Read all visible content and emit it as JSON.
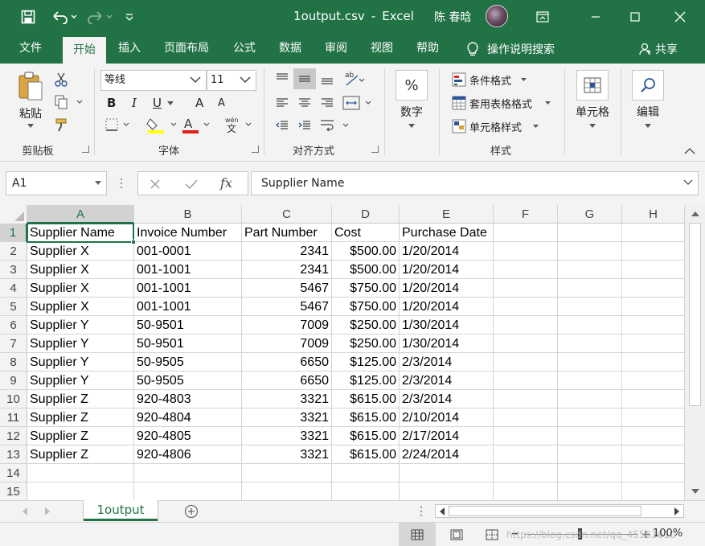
{
  "title_bar": {
    "file_name": "1output.csv",
    "separator": "-",
    "app_name": "Excel",
    "user_name": "陈 春晗"
  },
  "menu": {
    "tabs": [
      "文件",
      "开始",
      "插入",
      "页面布局",
      "公式",
      "数据",
      "审阅",
      "视图",
      "帮助"
    ],
    "active_tab": "开始",
    "tell_me": "操作说明搜索",
    "share": "共享"
  },
  "ribbon": {
    "clipboard": {
      "paste": "粘贴",
      "group_label": "剪贴板"
    },
    "font": {
      "font_name": "等线",
      "font_size": "11",
      "bold": "B",
      "italic": "I",
      "underline": "U",
      "grow": "A",
      "shrink": "A",
      "phonetic": "wén",
      "group_label": "字体"
    },
    "alignment": {
      "group_label": "对齐方式"
    },
    "number": {
      "percent_symbol": "%",
      "label": "数字"
    },
    "styles": {
      "conditional_format": "条件格式",
      "format_as_table": "套用表格格式",
      "cell_styles": "单元格样式",
      "group_label": "样式"
    },
    "cells": {
      "label": "单元格"
    },
    "editing": {
      "label": "编辑"
    }
  },
  "formula_bar": {
    "name_box": "A1",
    "fx": "fx",
    "content": "Supplier Name"
  },
  "sheet": {
    "columns": [
      "A",
      "B",
      "C",
      "D",
      "E",
      "F",
      "G",
      "H"
    ],
    "selected_column": "A",
    "selected_row": "1",
    "row_numbers": [
      "1",
      "2",
      "3",
      "4",
      "5",
      "6",
      "7",
      "8",
      "9",
      "10",
      "11",
      "12",
      "13",
      "14",
      "15"
    ],
    "rows": [
      [
        "Supplier Name",
        "Invoice Number",
        "Part Number",
        "Cost",
        "Purchase Date"
      ],
      [
        "Supplier X",
        "001-0001",
        "2341",
        "$500.00",
        "1/20/2014"
      ],
      [
        "Supplier X",
        "001-1001",
        "2341",
        "$500.00",
        "1/20/2014"
      ],
      [
        "Supplier X",
        "001-1001",
        "5467",
        "$750.00",
        "1/20/2014"
      ],
      [
        "Supplier X",
        "001-1001",
        "5467",
        "$750.00",
        "1/20/2014"
      ],
      [
        "Supplier Y",
        "50-9501",
        "7009",
        "$250.00",
        "1/30/2014"
      ],
      [
        "Supplier Y",
        "50-9501",
        "7009",
        "$250.00",
        "1/30/2014"
      ],
      [
        "Supplier Y",
        "50-9505",
        "6650",
        "$125.00",
        "2/3/2014"
      ],
      [
        "Supplier Y",
        "50-9505",
        "6650",
        "$125.00",
        "2/3/2014"
      ],
      [
        "Supplier Z",
        "920-4803",
        "3321",
        "$615.00",
        "2/3/2014"
      ],
      [
        "Supplier Z",
        "920-4804",
        "3321",
        "$615.00",
        "2/10/2014"
      ],
      [
        "Supplier Z",
        "920-4805",
        "3321",
        "$615.00",
        "2/17/2014"
      ],
      [
        "Supplier Z",
        "920-4806",
        "3321",
        "$615.00",
        "2/24/2014"
      ],
      [
        "",
        "",
        "",
        "",
        ""
      ],
      [
        "",
        "",
        "",
        "",
        ""
      ]
    ]
  },
  "sheet_tabs": {
    "active": "1output"
  },
  "status_bar": {
    "zoom": "100%",
    "watermark": "https://blog.csdn.net/qq_45563610"
  },
  "colors": {
    "accent": "#217346",
    "ribbon_bg": "#f3f3f3",
    "grid_line": "#d4d4d4"
  }
}
